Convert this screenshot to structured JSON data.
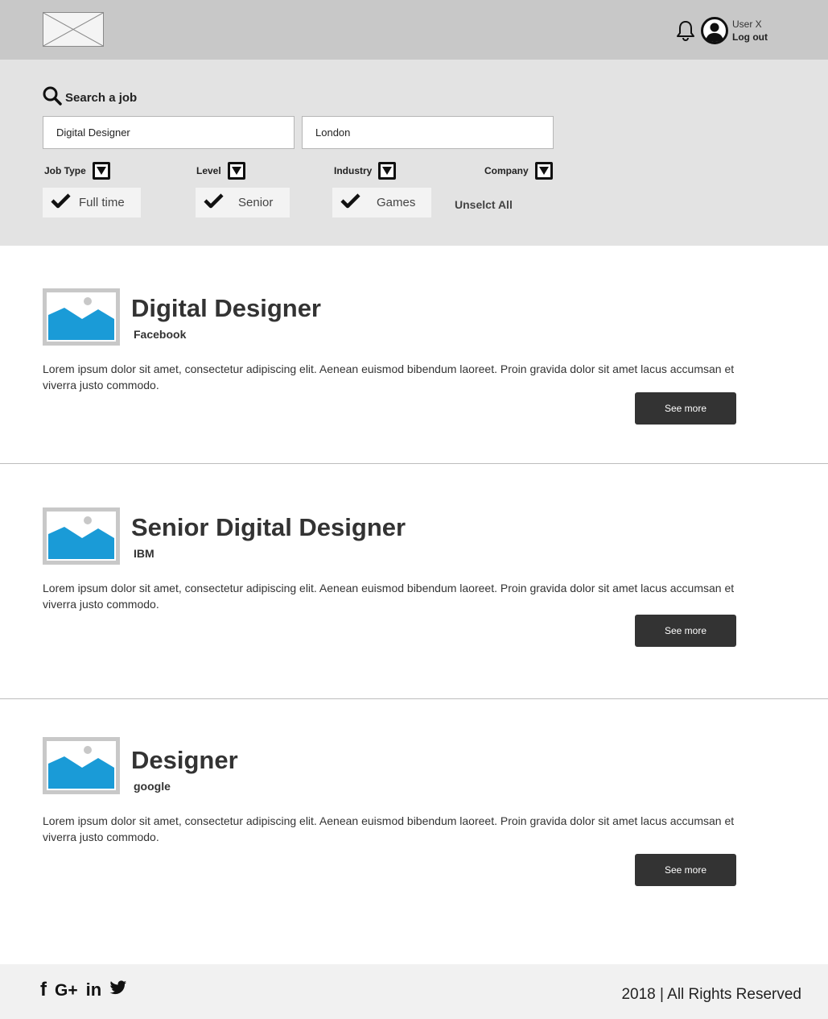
{
  "header": {
    "user_name": "User X",
    "logout_label": "Log out"
  },
  "search": {
    "title": "Search a job",
    "job_value": "Digital Designer",
    "location_value": "London",
    "filters": [
      {
        "label": "Job Type"
      },
      {
        "label": "Level"
      },
      {
        "label": "Industry"
      },
      {
        "label": "Company"
      }
    ],
    "chips": [
      {
        "label": "Full time"
      },
      {
        "label": "Senior"
      },
      {
        "label": "Games"
      }
    ],
    "unselect_label": "Unselct All"
  },
  "jobs": [
    {
      "title": "Digital Designer",
      "company": "Facebook",
      "description": "Lorem ipsum dolor sit amet, consectetur adipiscing elit. Aenean euismod bibendum laoreet. Proin gravida dolor sit amet lacus accumsan et viverra justo commodo.",
      "button": "See more"
    },
    {
      "title": "Senior Digital Designer",
      "company": "IBM",
      "description": "Lorem ipsum dolor sit amet, consectetur adipiscing elit. Aenean euismod bibendum laoreet. Proin gravida dolor sit amet lacus accumsan et viverra justo commodo.",
      "button": "See more"
    },
    {
      "title": "Designer",
      "company": "google",
      "description": "Lorem ipsum dolor sit amet, consectetur adipiscing elit. Aenean euismod bibendum laoreet. Proin gravida dolor sit amet lacus accumsan et viverra justo commodo.",
      "button": "See more"
    }
  ],
  "footer": {
    "social": [
      {
        "icon": "facebook-icon",
        "glyph": "f"
      },
      {
        "icon": "google-plus-icon",
        "glyph": "G+"
      },
      {
        "icon": "linkedin-icon",
        "glyph": "in"
      },
      {
        "icon": "twitter-icon",
        "glyph": "twitter-bird"
      }
    ],
    "copyright": "2018 | All Rights Reserved"
  },
  "colors": {
    "header_bg": "#c8c8c8",
    "search_bg": "#e3e3e3",
    "button_bg": "#333333",
    "image_placeholder": "#1a9bd7",
    "footer_bg": "#f1f1f1"
  }
}
